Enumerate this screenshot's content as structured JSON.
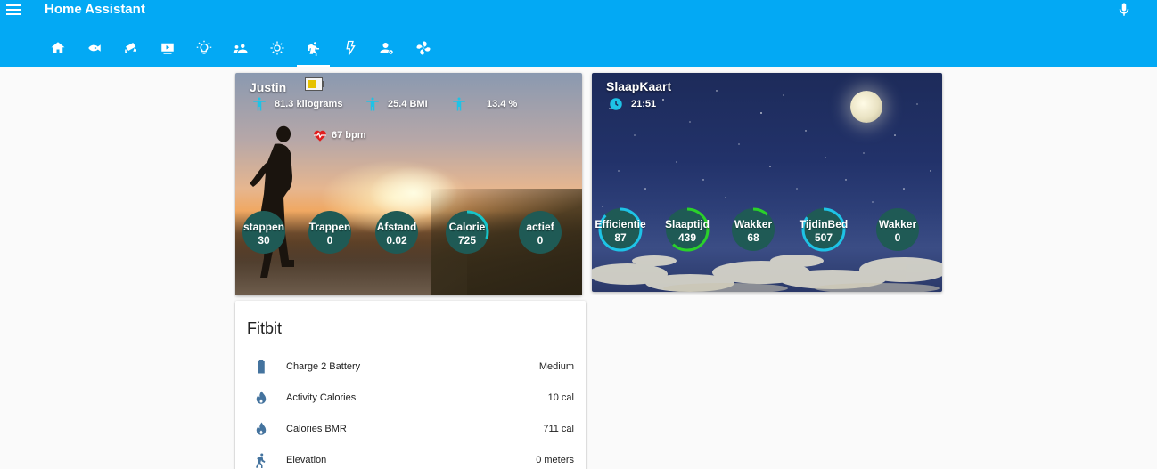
{
  "app": {
    "title": "Home Assistant"
  },
  "header": {
    "tabs": [
      {
        "icon": "home-icon"
      },
      {
        "icon": "fish-icon"
      },
      {
        "icon": "cctv-icon"
      },
      {
        "icon": "youtube-icon"
      },
      {
        "icon": "lightbulb-icon"
      },
      {
        "icon": "account-multiple-icon"
      },
      {
        "icon": "brightness-icon"
      },
      {
        "icon": "run-icon",
        "active": true
      },
      {
        "icon": "flash-icon"
      },
      {
        "icon": "account-settings-icon"
      },
      {
        "icon": "fan-icon"
      }
    ],
    "accent": "#03a9f4"
  },
  "justin": {
    "title": "Justin",
    "weight": "81.3 kilograms",
    "bmi": "25.4 BMI",
    "fat": "13.4 %",
    "heart": "67 bpm",
    "gauges": [
      {
        "label": "stappen",
        "value": "30",
        "percent": 0.0
      },
      {
        "label": "Trappen",
        "value": "0",
        "percent": 0.0
      },
      {
        "label": "Afstand",
        "value": "0.02",
        "percent": 0.0
      },
      {
        "label": "Calorie",
        "value": "725",
        "percent": 0.3
      },
      {
        "label": "actief",
        "value": "0",
        "percent": 0.0
      }
    ],
    "gauge_color": "#16c4c9",
    "gauge_bg": "#1f5a55"
  },
  "slaap": {
    "title": "SlaapKaart",
    "time": "21:51",
    "gauges": [
      {
        "label": "Efficientie",
        "value": "87",
        "percent": 0.87,
        "color": "#1ec3e6"
      },
      {
        "label": "Slaaptijd",
        "value": "439",
        "percent": 0.62,
        "color": "#2ad12a"
      },
      {
        "label": "Wakker",
        "value": "68",
        "percent": 0.12,
        "color": "#2ad12a"
      },
      {
        "label": "TijdinBed",
        "value": "507",
        "percent": 0.85,
        "color": "#1ec3e6"
      },
      {
        "label": "Wakker",
        "value": "0",
        "percent": 0.0,
        "color": "#1ec3e6"
      }
    ]
  },
  "fitbit": {
    "title": "Fitbit",
    "entities": [
      {
        "icon": "battery-icon",
        "name": "Charge 2 Battery",
        "state": "Medium"
      },
      {
        "icon": "fire-icon",
        "name": "Activity Calories",
        "state": "10 cal"
      },
      {
        "icon": "fire-icon",
        "name": "Calories BMR",
        "state": "711 cal"
      },
      {
        "icon": "walk-icon",
        "name": "Elevation",
        "state": "0 meters"
      }
    ],
    "icon_color": "#44739e"
  }
}
